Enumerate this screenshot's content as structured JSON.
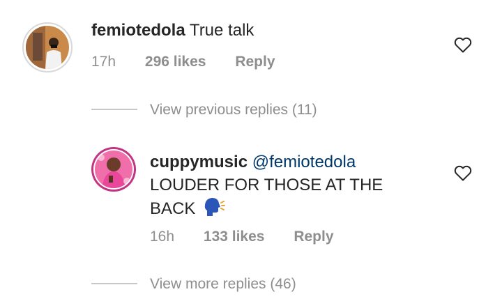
{
  "comment": {
    "username": "femiotedola",
    "text": "True talk",
    "time": "17h",
    "likes": "296 likes",
    "reply_label": "Reply",
    "heart_icon": "heart-outline-icon"
  },
  "view_previous": {
    "label": "View previous replies (11)"
  },
  "reply": {
    "username": "cuppymusic",
    "mention": "@femiotedola",
    "text_line1": "LOUDER FOR THOSE AT THE",
    "text_line2": "BACK",
    "emoji": "🗣",
    "time": "16h",
    "likes": "133 likes",
    "reply_label": "Reply",
    "heart_icon": "heart-outline-icon"
  },
  "view_more": {
    "label": "View more replies (46)"
  },
  "colors": {
    "text": "#262626",
    "meta": "#8e8e8e",
    "mention": "#00376b",
    "reply_ring": "#c13584"
  }
}
